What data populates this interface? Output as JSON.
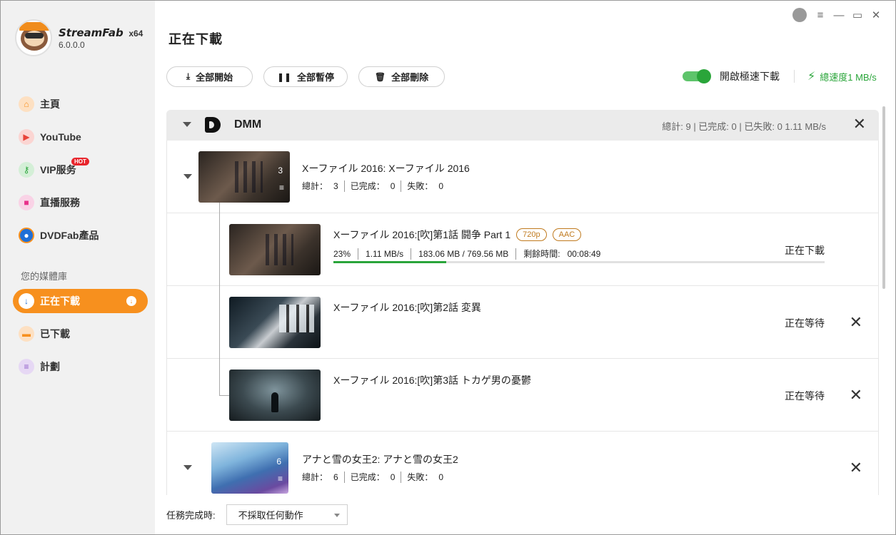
{
  "app": {
    "brand_name": "StreamFab",
    "arch": "x64",
    "version": "6.0.0.0"
  },
  "sidebar": {
    "items": [
      {
        "label": "主頁",
        "icon": "home-icon",
        "color": "#f7901e"
      },
      {
        "label": "YouTube",
        "icon": "youtube-icon",
        "color": "#e8443a"
      },
      {
        "label": "VIP服务",
        "icon": "key-icon",
        "color": "#2aa53a",
        "badge": "HOT"
      },
      {
        "label": "直播服務",
        "icon": "camera-icon",
        "color": "#e8308a"
      },
      {
        "label": "DVDFab產品",
        "icon": "dvdfab-icon",
        "color": "#1f6fd6"
      }
    ],
    "library_label": "您的媒體庫",
    "library": [
      {
        "label": "正在下載",
        "icon": "download-icon",
        "active": true
      },
      {
        "label": "已下載",
        "icon": "folder-icon",
        "color": "#f7901e"
      },
      {
        "label": "計劃",
        "icon": "list-icon",
        "color": "#8e5cc7"
      }
    ]
  },
  "window_controls": [
    "theme-icon",
    "menu-icon",
    "minimize-icon",
    "maximize-icon",
    "close-icon"
  ],
  "main": {
    "title": "正在下載",
    "toolbar": {
      "start_all": "全部開始",
      "pause_all": "全部暫停",
      "delete_all": "全部刪除"
    },
    "turbo_label": "開啟極速下載",
    "turbo_on": true,
    "total_speed": "總速度1 MB/s"
  },
  "group": {
    "name": "DMM",
    "stats": "總計: 9 | 已完成: 0 | 已失敗: 0    1.11 MB/s"
  },
  "series": [
    {
      "title": "Xーファイル 2016: Xーファイル 2016",
      "count": "3",
      "total_label": "總計：",
      "total": "3",
      "done_label": "已完成：",
      "done": "0",
      "failed_label": "失敗：",
      "failed": "0"
    },
    {
      "title": "アナと雪の女王2: アナと雪の女王2",
      "count": "6",
      "total_label": "總計：",
      "total": "6",
      "done_label": "已完成：",
      "done": "0",
      "failed_label": "失敗：",
      "failed": "0"
    }
  ],
  "episodes": [
    {
      "title": "Xーファイル 2016:[吹]第1話 闘争 Part 1",
      "quality": "720p",
      "audio": "AAC",
      "percent": "23%",
      "progress": 0.23,
      "speed": "1.11 MB/s",
      "size": "183.06 MB / 769.56 MB",
      "remaining": "剩餘時間:   00:08:49",
      "status": "正在下載"
    },
    {
      "title": "Xーファイル 2016:[吹]第2話 変異",
      "status": "正在等待"
    },
    {
      "title": "Xーファイル 2016:[吹]第3話 トカゲ男の憂鬱",
      "status": "正在等待"
    }
  ],
  "footer": {
    "label": "任務完成時:",
    "select_value": "不採取任何動作"
  }
}
